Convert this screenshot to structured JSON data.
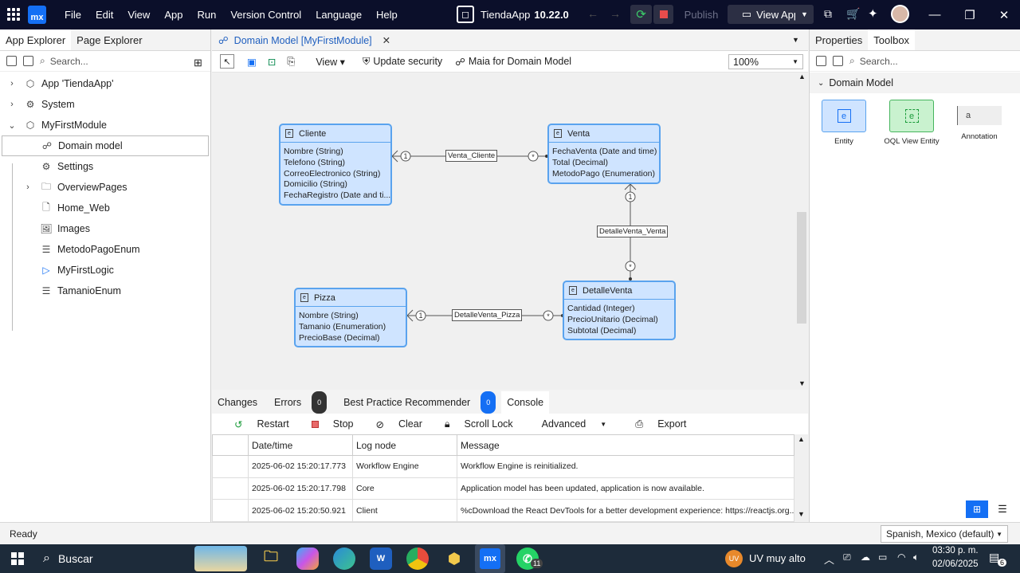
{
  "titlebar": {
    "menu": [
      "File",
      "Edit",
      "View",
      "App",
      "Run",
      "Version Control",
      "Language",
      "Help"
    ],
    "app_name": "TiendaApp",
    "version": "10.22.0",
    "publish_label": "Publish",
    "view_app_label": "View App",
    "logo_text": "mx"
  },
  "left_panel": {
    "tabs": [
      "App Explorer",
      "Page Explorer"
    ],
    "search_placeholder": "Search...",
    "tree": [
      {
        "label": "App 'TiendaApp'",
        "icon": "cube-icon"
      },
      {
        "label": "System",
        "icon": "gear-group-icon"
      },
      {
        "label": "MyFirstModule",
        "icon": "module-icon"
      },
      {
        "label": "Domain model",
        "icon": "domain-model-icon"
      },
      {
        "label": "Settings",
        "icon": "gear-icon"
      },
      {
        "label": "OverviewPages",
        "icon": "folder-icon"
      },
      {
        "label": "Home_Web",
        "icon": "page-icon"
      },
      {
        "label": "Images",
        "icon": "image-icon"
      },
      {
        "label": "MetodoPagoEnum",
        "icon": "enumeration-icon"
      },
      {
        "label": "MyFirstLogic",
        "icon": "microflow-icon"
      },
      {
        "label": "TamanioEnum",
        "icon": "enumeration-icon"
      }
    ]
  },
  "editor": {
    "doc_tab": "Domain Model [MyFirstModule]",
    "toolbar": {
      "view_label": "View",
      "update_security": "Update security",
      "maia": "Maia for Domain Model",
      "zoom": "100%"
    },
    "entities": {
      "cliente": {
        "name": "Cliente",
        "attrs": [
          "Nombre (String)",
          "Telefono (String)",
          "CorreoElectronico (String)",
          "Domicilio (String)",
          "FechaRegistro (Date and ti..."
        ]
      },
      "venta": {
        "name": "Venta",
        "attrs": [
          "FechaVenta (Date and time)",
          "Total (Decimal)",
          "MetodoPago (Enumeration)"
        ]
      },
      "pizza": {
        "name": "Pizza",
        "attrs": [
          "Nombre (String)",
          "Tamanio (Enumeration)",
          "PrecioBase (Decimal)"
        ]
      },
      "detalle": {
        "name": "DetalleVenta",
        "attrs": [
          "Cantidad (Integer)",
          "PrecioUnitario (Decimal)",
          "Subtotal (Decimal)"
        ]
      }
    },
    "associations": {
      "venta_cliente": "Venta_Cliente",
      "detalle_venta": "DetalleVenta_Venta",
      "detalle_pizza": "DetalleVenta_Pizza"
    },
    "multiplicity": {
      "one": "1",
      "many": "*"
    }
  },
  "bottom_panel": {
    "tabs": {
      "changes": "Changes",
      "errors": "Errors",
      "errors_count": "0",
      "bpr": "Best Practice Recommender",
      "bpr_count": "0",
      "console": "Console"
    },
    "tools": {
      "restart": "Restart",
      "stop": "Stop",
      "clear": "Clear",
      "scroll_lock": "Scroll Lock",
      "advanced": "Advanced",
      "export": "Export"
    },
    "columns": [
      "Date/time",
      "Log node",
      "Message"
    ],
    "rows": [
      [
        "2025-06-02 15:20:17.773",
        "Workflow Engine",
        "Workflow Engine is reinitialized."
      ],
      [
        "2025-06-02 15:20:17.798",
        "Core",
        "Application model has been updated, application is now available."
      ],
      [
        "2025-06-02 15:20:50.921",
        "Client",
        "%cDownload the React DevTools for a better development experience: https://reactjs.org..."
      ]
    ]
  },
  "right_panel": {
    "tabs": [
      "Properties",
      "Toolbox"
    ],
    "search_placeholder": "Search...",
    "section": "Domain Model",
    "tools": [
      "Entity",
      "OQL View Entity",
      "Annotation"
    ]
  },
  "statusbar": {
    "status": "Ready",
    "language": "Spanish, Mexico (default)"
  },
  "taskbar": {
    "search": "Buscar",
    "weather_badge": "UV",
    "weather": "UV muy alto",
    "time": "03:30 p. m.",
    "date": "02/06/2025",
    "whatsapp_count": "11",
    "notif_count": "6"
  },
  "colors": {
    "accent": "#146ff4",
    "entity_fill": "#cfe4ff",
    "entity_border": "#5aa3ee",
    "titlebar": "#0b0f2a",
    "taskbar": "#1d2b3a"
  }
}
